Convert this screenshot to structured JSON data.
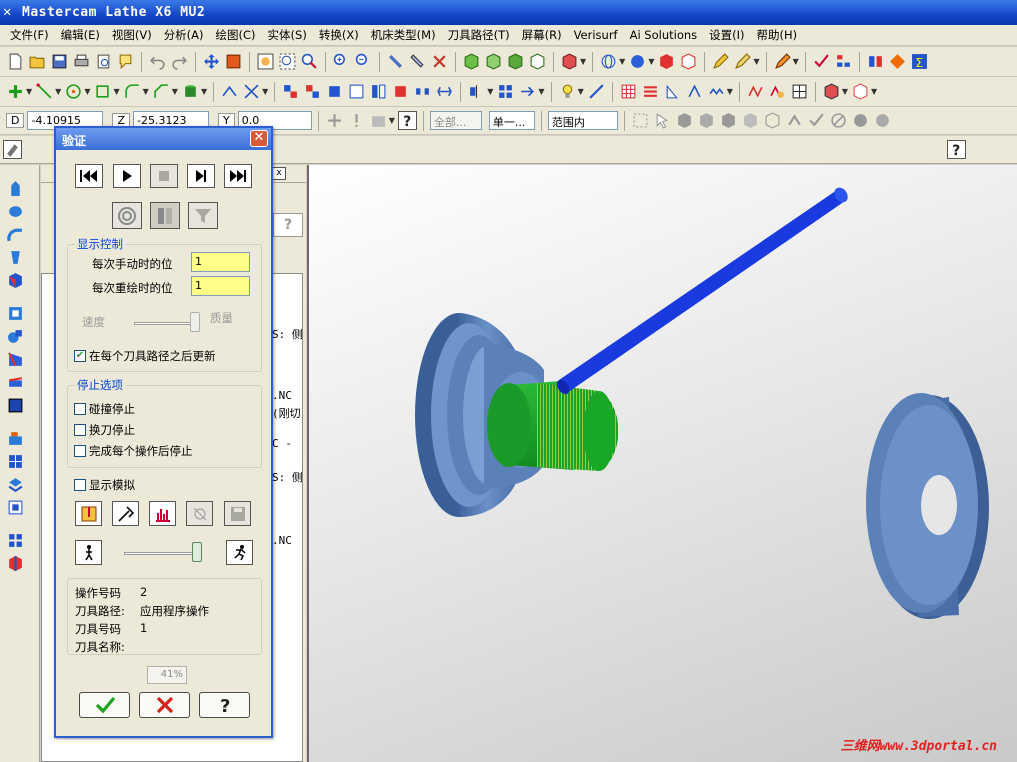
{
  "app": {
    "title": "Mastercam Lathe X6 MU2"
  },
  "menu": [
    "文件(F)",
    "编辑(E)",
    "视图(V)",
    "分析(A)",
    "绘图(C)",
    "实体(S)",
    "转换(X)",
    "机床类型(M)",
    "刀具路径(T)",
    "屏幕(R)",
    "Verisurf",
    "Ai Solutions",
    "设置(I)",
    "帮助(H)"
  ],
  "coords": {
    "d_label": "D",
    "d_value": "-4.10915",
    "z_label": "Z",
    "z_value": "-25.3123",
    "y_label": "Y",
    "y_value": "0.0",
    "select_all": "全部...",
    "select_single": "单一...",
    "range_option": "范围内"
  },
  "ops_panel_text": [
    "S: 侧",
    ".NC",
    "(刚切",
    "C -",
    "S: 侧",
    ".NC"
  ],
  "dialog": {
    "title": "验证",
    "display_group": "显示控制",
    "manual_step_label": "每次手动时的位",
    "manual_step_value": "1",
    "redraw_step_label": "每次重绘时的位",
    "redraw_step_value": "1",
    "speed_label": "速度",
    "quality_label": "质量",
    "update_after_path_label": "在每个刀具路径之后更新",
    "update_after_path_checked": true,
    "stop_group": "停止选项",
    "stop_on_collision": "碰撞停止",
    "stop_on_tool_change": "换刀停止",
    "stop_after_each_op": "完成每个操作后停止",
    "show_simulation": "显示模拟",
    "info": {
      "op_number_label": "操作号码",
      "op_number_value": "2",
      "toolpath_label": "刀具路径:",
      "toolpath_value": "应用程序操作",
      "tool_number_label": "刀具号码",
      "tool_number_value": "1",
      "tool_name_label": "刀具名称:",
      "tool_name_value": ""
    },
    "progress_text": "41%",
    "progress": 0.41,
    "sim_speed_level": 0.95
  },
  "watermark": "三维网www.3dportal.cn",
  "colors": {
    "title_blue": "#1447c8",
    "part_blue": "#5b82b8",
    "tool_green": "#1e9e2a",
    "rod_blue": "#1a3ae0",
    "field_yellow": "#ffff88"
  }
}
